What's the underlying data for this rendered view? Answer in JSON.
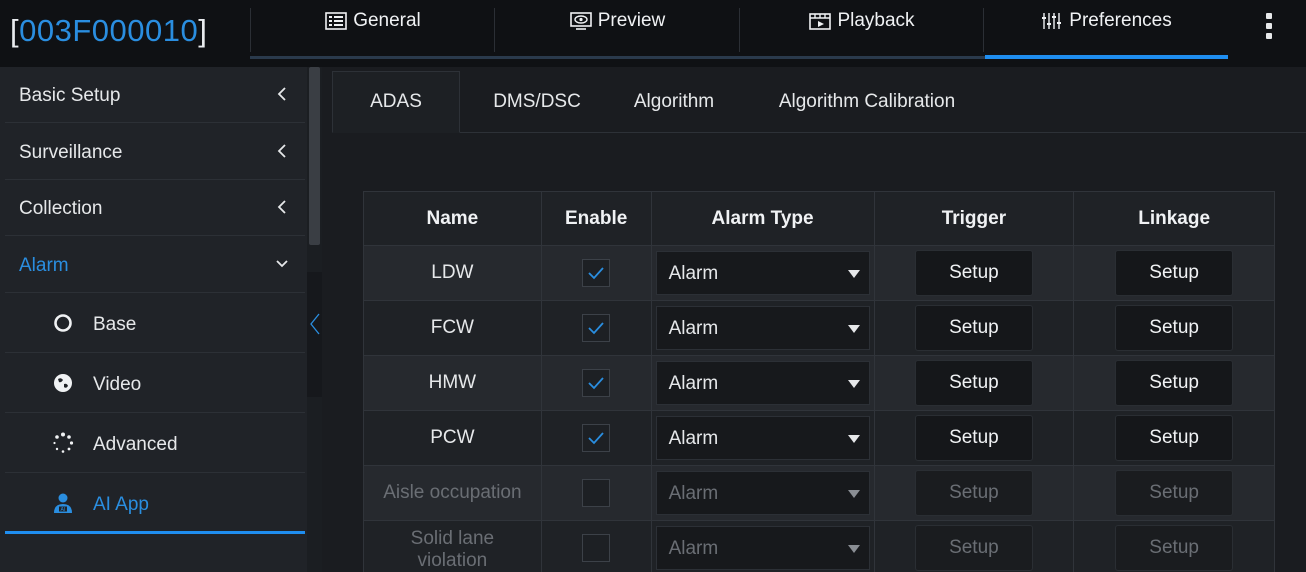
{
  "header": {
    "device_id": "003F000010",
    "bracket_open": "[",
    "bracket_close": "]",
    "tabs": [
      {
        "label": "General",
        "icon": "general-icon"
      },
      {
        "label": "Preview",
        "icon": "preview-icon"
      },
      {
        "label": "Playback",
        "icon": "playback-icon"
      },
      {
        "label": "Preferences",
        "icon": "preferences-icon",
        "active": true
      }
    ],
    "menu_icon": "kebab-menu-icon"
  },
  "sidebar": {
    "groups": [
      {
        "label": "Basic Setup",
        "expanded": false
      },
      {
        "label": "Surveillance",
        "expanded": false
      },
      {
        "label": "Collection",
        "expanded": false
      },
      {
        "label": "Alarm",
        "expanded": true
      }
    ],
    "sub_items": [
      {
        "label": "Base",
        "icon": "circle-icon"
      },
      {
        "label": "Video",
        "icon": "globe-icon"
      },
      {
        "label": "Advanced",
        "icon": "dots-spinner-icon"
      },
      {
        "label": "AI App",
        "icon": "ai-user-icon",
        "selected": true
      }
    ]
  },
  "main": {
    "tabs": [
      {
        "label": "ADAS",
        "active": true
      },
      {
        "label": "DMS/DSC"
      },
      {
        "label": "Algorithm"
      },
      {
        "label": "Algorithm Calibration"
      }
    ],
    "table": {
      "columns": [
        "Name",
        "Enable",
        "Alarm Type",
        "Trigger",
        "Linkage"
      ],
      "rows": [
        {
          "name": "LDW",
          "enabled": true,
          "alarm_type": "Alarm",
          "trigger": "Setup",
          "linkage": "Setup",
          "disabled": false
        },
        {
          "name": "FCW",
          "enabled": true,
          "alarm_type": "Alarm",
          "trigger": "Setup",
          "linkage": "Setup",
          "disabled": false
        },
        {
          "name": "HMW",
          "enabled": true,
          "alarm_type": "Alarm",
          "trigger": "Setup",
          "linkage": "Setup",
          "disabled": false
        },
        {
          "name": "PCW",
          "enabled": true,
          "alarm_type": "Alarm",
          "trigger": "Setup",
          "linkage": "Setup",
          "disabled": false
        },
        {
          "name": "Aisle occupation",
          "enabled": false,
          "alarm_type": "Alarm",
          "trigger": "Setup",
          "linkage": "Setup",
          "disabled": true
        },
        {
          "name": "Solid lane violation",
          "enabled": false,
          "alarm_type": "Alarm",
          "trigger": "Setup",
          "linkage": "Setup",
          "disabled": true
        }
      ]
    }
  },
  "colors": {
    "accent": "#1f8ef0",
    "background": "#1a1c20",
    "sidebar": "#202328",
    "check": "#2a8ee0"
  }
}
